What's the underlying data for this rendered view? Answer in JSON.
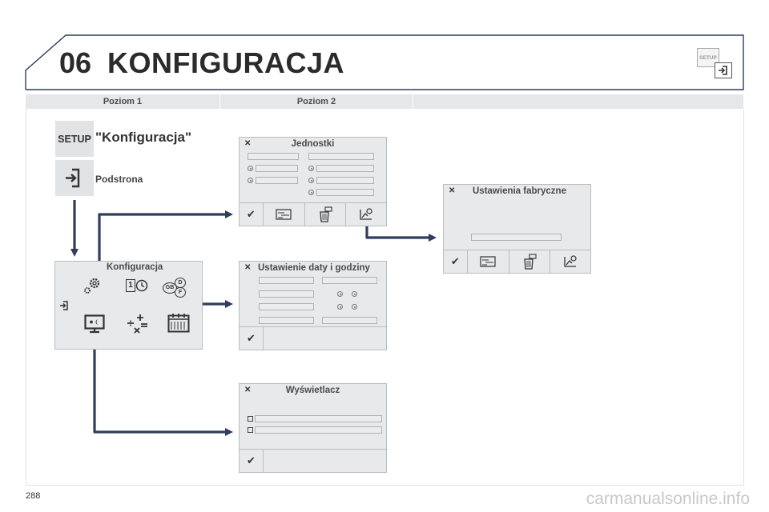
{
  "header": {
    "chapter_number": "06",
    "title": "KONFIGURACJA",
    "setup_label": "SETUP"
  },
  "columns": {
    "level1": "Poziom 1",
    "level2": "Poziom 2"
  },
  "level1": {
    "setup_label": "SETUP",
    "setup_caption": "\"Konfiguracja\"",
    "subpage_caption": "Podstrona",
    "menu_title": "Konfiguracja",
    "menu_badge": "1",
    "lang_codes": [
      "GB",
      "D",
      "F"
    ]
  },
  "panels": {
    "units": {
      "title": "Jednostki",
      "close": "✕"
    },
    "datetime": {
      "title": "Ustawienie daty i godziny",
      "close": "✕"
    },
    "display": {
      "title": "Wyświetlacz",
      "close": "✕"
    },
    "factory": {
      "title": "Ustawienia fabryczne",
      "close": "✕"
    }
  },
  "buttons": {
    "ok": "✔"
  },
  "icons": [
    "setup-icon",
    "exit-icon",
    "gear-icon",
    "clock-icon",
    "language-icon",
    "display-icon",
    "calculator-icon",
    "calendar-icon",
    "default-icon",
    "trash-icon",
    "reset-icon",
    "checkbox-icon",
    "check-icon",
    "close-icon"
  ],
  "page_number": "288",
  "footer": "carmanualsonline.info",
  "colors": {
    "connector": "#2e3e5c",
    "panel_bg": "#e8e9eb",
    "header_line": "#2e3e5c"
  }
}
